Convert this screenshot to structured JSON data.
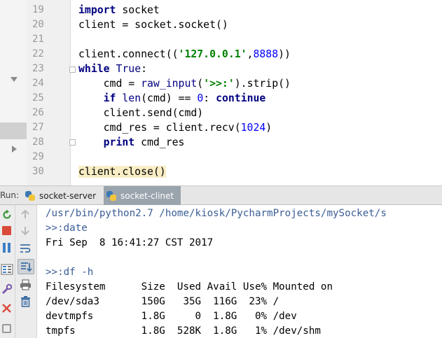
{
  "editor": {
    "line_numbers": [
      "19",
      "20",
      "21",
      "22",
      "23",
      "24",
      "25",
      "26",
      "27",
      "28",
      "29",
      "30"
    ],
    "lines": {
      "l19": {
        "kw": "import",
        "rest": " socket"
      },
      "l20": {
        "text": "client = socket.socket()"
      },
      "l22": {
        "a": "client.connect((",
        "str": "'127.0.0.1'",
        "b": ",",
        "num": "8888",
        "c": "))"
      },
      "l23": {
        "kw": "while",
        "sp": " ",
        "bi": "True",
        "rest": ":"
      },
      "l24": {
        "a": "    cmd = ",
        "bi": "raw_input",
        "b": "(",
        "str": "'>>:'",
        "c": ").strip()"
      },
      "l25": {
        "indent": "    ",
        "kw1": "if",
        "sp": " ",
        "bi": "len",
        "a": "(cmd) == ",
        "num": "0",
        "b": ": ",
        "kw2": "continue"
      },
      "l26": {
        "text": "    client.send(cmd)"
      },
      "l27": {
        "a": "    cmd_res = client.recv(",
        "num": "1024",
        "b": ")"
      },
      "l28": {
        "indent": "    ",
        "kw": "print",
        "rest": " cmd_res"
      },
      "l30": {
        "text": "client.close()"
      }
    }
  },
  "run": {
    "label": "Run:",
    "tabs": [
      {
        "label": "socket-server",
        "active": false
      },
      {
        "label": "socket-clinet",
        "active": true
      }
    ]
  },
  "console": {
    "lines": [
      {
        "text": "/usr/bin/python2.7 /home/kiosk/PycharmProjects/mySocket/s",
        "type": "cmd"
      },
      {
        "text": ">>:date",
        "type": "cmd"
      },
      {
        "text": "Fri Sep  8 16:41:27 CST 2017",
        "type": "out"
      },
      {
        "text": "",
        "type": "out"
      },
      {
        "text": ">>:df -h",
        "type": "cmd"
      },
      {
        "text": "Filesystem      Size  Used Avail Use% Mounted on",
        "type": "out"
      },
      {
        "text": "/dev/sda3       150G   35G  116G  23% /",
        "type": "out"
      },
      {
        "text": "devtmpfs        1.8G     0  1.8G   0% /dev",
        "type": "out"
      },
      {
        "text": "tmpfs           1.8G  528K  1.8G   1% /dev/shm",
        "type": "out"
      }
    ]
  },
  "colors": {
    "keyword": "#000080",
    "string": "#008000",
    "number": "#0000ff",
    "console_input": "#3a5d95",
    "active_tab": "#9aa4ad",
    "highlight": "#f8edc4"
  },
  "icons": {
    "toolbar_a": [
      "rerun-icon",
      "stop-icon",
      "pause-icon",
      "layout-icon",
      "settings-icon",
      "close-icon"
    ],
    "toolbar_b": [
      "up-arrow-icon",
      "down-arrow-icon",
      "soft-wrap-icon",
      "scroll-to-end-icon",
      "print-icon",
      "trash-icon"
    ]
  }
}
